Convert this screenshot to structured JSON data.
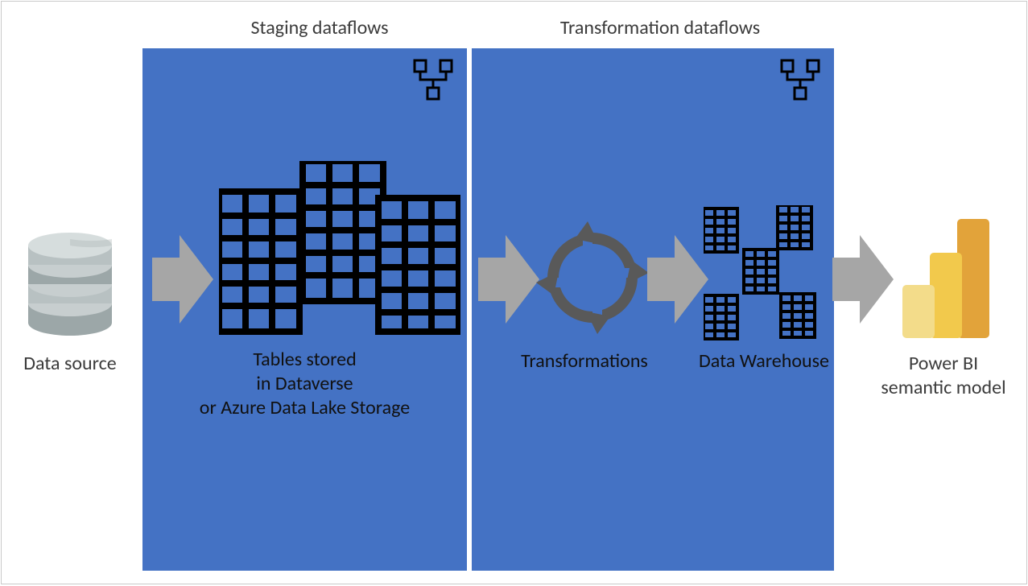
{
  "titles": {
    "staging": "Staging dataflows",
    "transformation": "Transformation dataflows"
  },
  "labels": {
    "data_source": "Data source",
    "tables_line1": "Tables stored",
    "tables_line2": "in Dataverse",
    "tables_line3": "or Azure Data Lake Storage",
    "transformations": "Transformations",
    "data_warehouse": "Data Warehouse",
    "powerbi_line1": "Power BI",
    "powerbi_line2": "semantic model"
  },
  "colors": {
    "panel_blue": "#4472c4",
    "arrow_gray": "#a6a6a6",
    "cyl_light": "#c7cecf",
    "cyl_mid": "#b8c1c2",
    "cyl_dark": "#9ca7a8",
    "pbi_yellow1": "#f3dc8a",
    "pbi_yellow2": "#f2c94c",
    "pbi_yellow3": "#e2a33a"
  }
}
